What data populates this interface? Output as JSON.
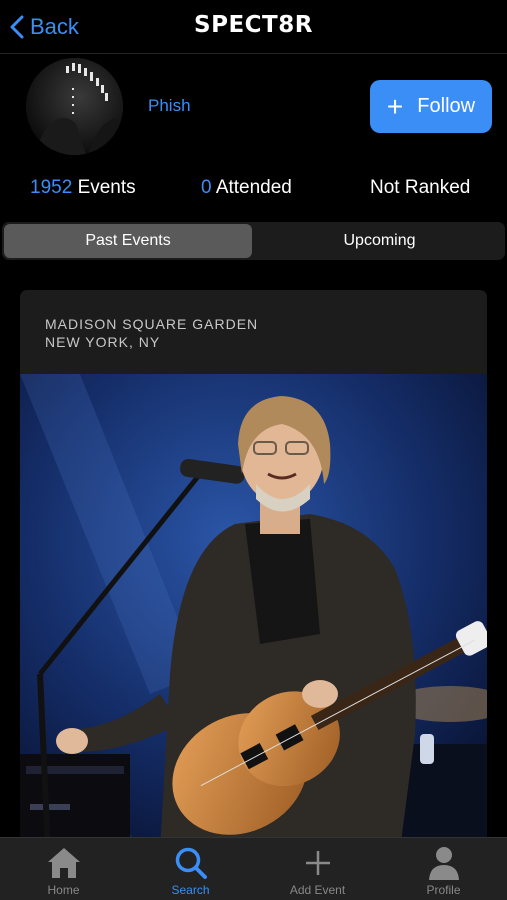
{
  "nav": {
    "back_label": "Back",
    "logo_text": "SPECT8R"
  },
  "artist": {
    "name": "Phish",
    "follow_label": "Follow"
  },
  "stats": {
    "events_count": "1952",
    "events_label": "Events",
    "attended_count": "0",
    "attended_label": "Attended",
    "rank_label": "Not Ranked"
  },
  "segments": {
    "past": "Past Events",
    "upcoming": "Upcoming",
    "selected": "Past Events"
  },
  "event_card": {
    "venue": "MADISON SQUARE GARDEN",
    "location": "NEW YORK, NY"
  },
  "tabbar": {
    "items": [
      {
        "label": "Home",
        "icon": "home-icon"
      },
      {
        "label": "Search",
        "icon": "search-icon"
      },
      {
        "label": "Add Event",
        "icon": "plus-icon"
      },
      {
        "label": "Profile",
        "icon": "profile-icon"
      }
    ],
    "active": "Search"
  },
  "colors": {
    "accent": "#3a8ef6",
    "background": "#000000",
    "card": "#1c1c1c",
    "tabbar": "#222222"
  }
}
